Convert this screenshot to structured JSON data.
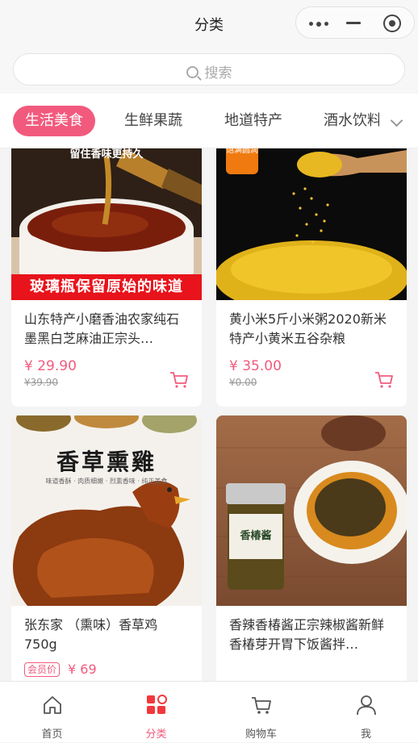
{
  "nav": {
    "title": "分类"
  },
  "search": {
    "placeholder": "搜索"
  },
  "tabs": [
    {
      "label": "生活美食",
      "active": true
    },
    {
      "label": "生鲜果蔬"
    },
    {
      "label": "地道特产"
    },
    {
      "label": "酒水饮料"
    }
  ],
  "products": [
    {
      "image_banner": "玻璃瓶保留原始的味道",
      "image_top_text": "留住香味更持久",
      "title": "山东特产小磨香油农家纯石墨黑白芝麻油正宗头…",
      "price": "¥ 29.90",
      "old_price": "¥39.90"
    },
    {
      "image_badge": "饱满圆润",
      "title": "黄小米5斤小米粥2020新米特产小黄米五谷杂粮",
      "price": "¥ 35.00",
      "old_price": "¥0.00"
    },
    {
      "image_headline": "香草熏雞",
      "image_subtext": "味道香酥 · 肉质细嫩 · 烈熏香味 · 纯正美食",
      "title": "张东家 （熏味）香草鸡 750g",
      "member_tag": "会员价",
      "price": "¥ 69"
    },
    {
      "jar_label": "香椿酱",
      "title": "香辣香椿酱正宗辣椒酱新鲜香椿芽开胃下饭酱拌…"
    }
  ],
  "tabbar": [
    {
      "label": "首页",
      "icon": "home-icon"
    },
    {
      "label": "分类",
      "icon": "category-icon",
      "active": true
    },
    {
      "label": "购物车",
      "icon": "cart-icon"
    },
    {
      "label": "我",
      "icon": "user-icon"
    }
  ],
  "colors": {
    "accent": "#f25a7d",
    "background": "#f4f4f4"
  }
}
